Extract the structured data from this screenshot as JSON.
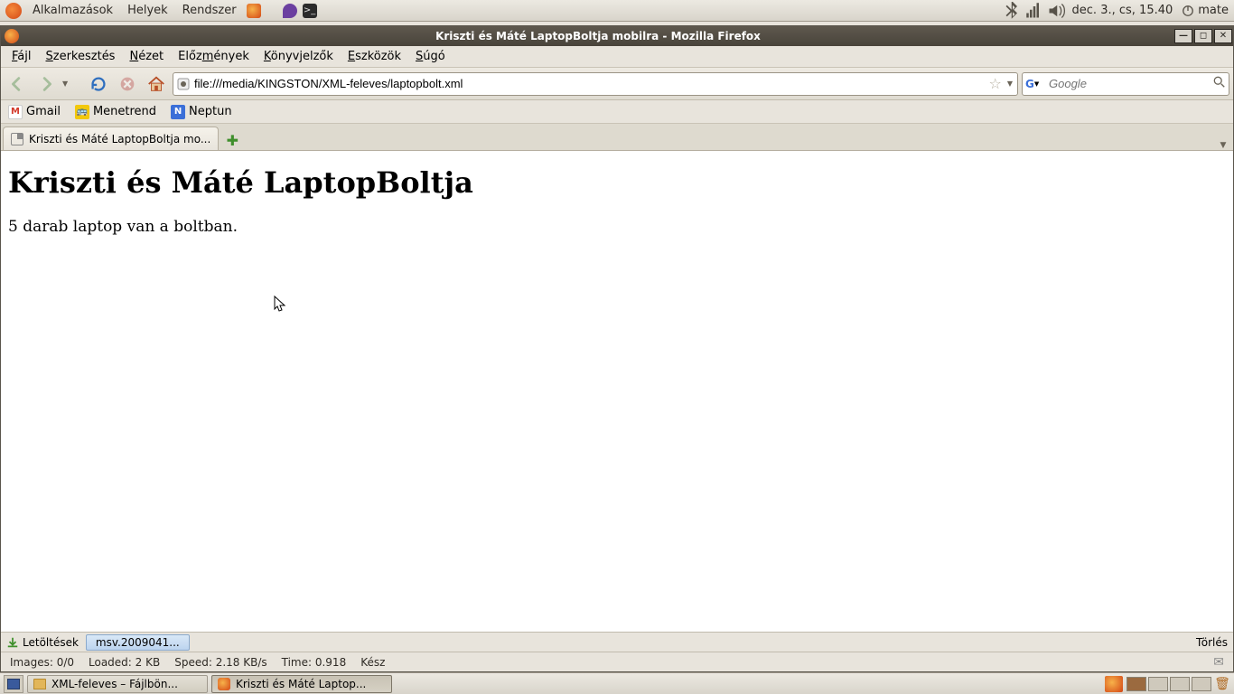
{
  "gnome_panel": {
    "menus": [
      "Alkalmazások",
      "Helyek",
      "Rendszer"
    ],
    "clock": "dec.  3., cs, 15.40",
    "user": "mate"
  },
  "firefox": {
    "window_title": "Kriszti és Máté LaptopBoltja mobilra - Mozilla Firefox",
    "menubar": [
      {
        "label": "Fájl",
        "u": "F"
      },
      {
        "label": "Szerkesztés",
        "u": "S"
      },
      {
        "label": "Nézet",
        "u": "N"
      },
      {
        "label": "Előzmények",
        "u": "m"
      },
      {
        "label": "Könyvjelzők",
        "u": "K"
      },
      {
        "label": "Eszközök",
        "u": "E"
      },
      {
        "label": "Súgó",
        "u": "S"
      }
    ],
    "url": "file:///media/KINGSTON/XML-feleves/laptopbolt.xml",
    "search_placeholder": "Google",
    "bookmarks": [
      {
        "label": "Gmail",
        "icon": "gmail"
      },
      {
        "label": "Menetrend",
        "icon": "bus"
      },
      {
        "label": "Neptun",
        "icon": "neptun"
      }
    ],
    "tabs": [
      {
        "label": "Kriszti és Máté LaptopBoltja mo..."
      }
    ],
    "page": {
      "heading": "Kriszti és Máté LaptopBoltja",
      "body": "5 darab laptop van a boltban."
    },
    "download_bar": {
      "label": "Letöltések",
      "item": "msv.2009041...",
      "clear": "Törlés"
    },
    "status": {
      "images": "Images: 0/0",
      "loaded": "Loaded: 2 KB",
      "speed": "Speed: 2.18 KB/s",
      "time": "Time: 0.918",
      "state": "Kész"
    }
  },
  "bottom_panel": {
    "tasks": [
      {
        "label": "XML-feleves – Fájlbön...",
        "icon": "folder"
      },
      {
        "label": "Kriszti és Máté Laptop...",
        "icon": "firefox",
        "active": true
      }
    ]
  }
}
